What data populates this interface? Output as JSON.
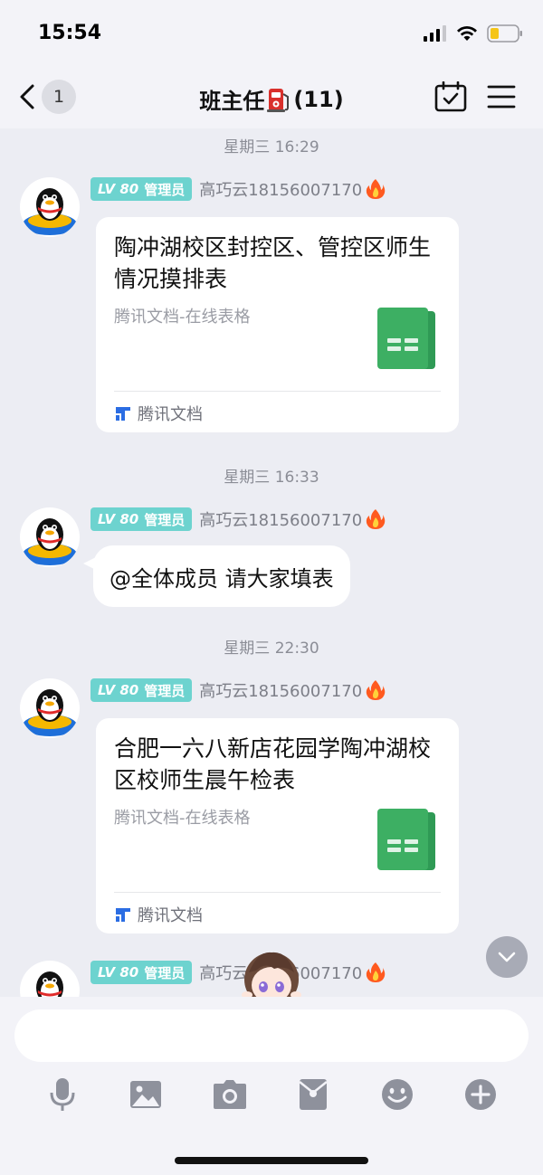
{
  "status_bar": {
    "time": "15:54"
  },
  "nav": {
    "back_count": "1",
    "title": "班主任",
    "title_icon": "fuel-pump-emoji",
    "member_count": "(11)"
  },
  "colors": {
    "lv_badge": "#6dd3cf",
    "doc_green": "#3daf63",
    "background": "#ecedf3"
  },
  "messages": [
    {
      "time": "星期三 16:29",
      "level": "LV 80",
      "role": "管理员",
      "sender": "高巧云18156007170",
      "type": "doc",
      "doc_title": "陶冲湖校区封控区、管控区师生情况摸排表",
      "doc_subtitle": "腾讯文档-在线表格",
      "doc_source": "腾讯文档"
    },
    {
      "time": "星期三 16:33",
      "level": "LV 80",
      "role": "管理员",
      "sender": "高巧云18156007170",
      "type": "text",
      "text": "@全体成员 请大家填表"
    },
    {
      "time": "星期三 22:30",
      "level": "LV 80",
      "role": "管理员",
      "sender": "高巧云18156007170",
      "type": "doc",
      "doc_title": "合肥一六八新店花园学陶冲湖校区校师生晨午检表",
      "doc_subtitle": "腾讯文档-在线表格",
      "doc_source": "腾讯文档"
    },
    {
      "level": "LV 80",
      "role": "管理员",
      "sender": "高巧云18156007170",
      "type": "partial"
    }
  ],
  "input": {
    "placeholder": ""
  },
  "toolbar": [
    "microphone-icon",
    "image-icon",
    "camera-icon",
    "red-packet-icon",
    "emoji-icon",
    "plus-icon"
  ]
}
